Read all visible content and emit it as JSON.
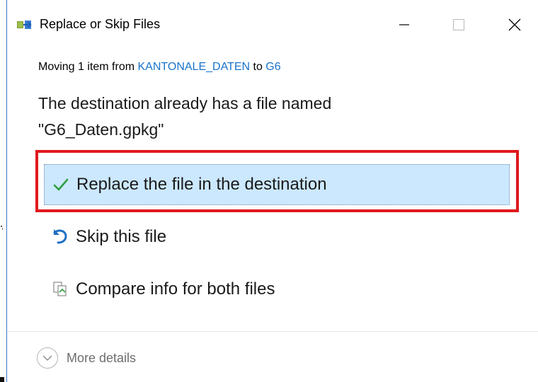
{
  "window": {
    "title": "Replace or Skip Files",
    "icon": "folder-move-icon",
    "controls": {
      "minimize": "minimize-icon",
      "maximize": "maximize-icon",
      "close": "close-icon"
    }
  },
  "progress": {
    "prefix": "Moving 1 item from ",
    "source": "KANTONALE_DATEN",
    "connector": " to ",
    "destination": "G6"
  },
  "message": {
    "line1": "The destination already has a file named",
    "line2": "\"G6_Daten.gpkg\""
  },
  "options": [
    {
      "label": "Replace the file in the destination",
      "icon": "checkmark-icon",
      "selected": true
    },
    {
      "label": "Skip this file",
      "icon": "skip-arrow-icon",
      "selected": false
    },
    {
      "label": "Compare info for both files",
      "icon": "compare-files-icon",
      "selected": false
    }
  ],
  "footer": {
    "more_details": "More details",
    "icon": "chevron-down-icon"
  },
  "colors": {
    "accent_link": "#1a73c9",
    "selected_bg": "#cce8ff",
    "highlight_border": "#e0191e",
    "check_green": "#2e9d3e",
    "skip_blue": "#1e6fc4"
  }
}
